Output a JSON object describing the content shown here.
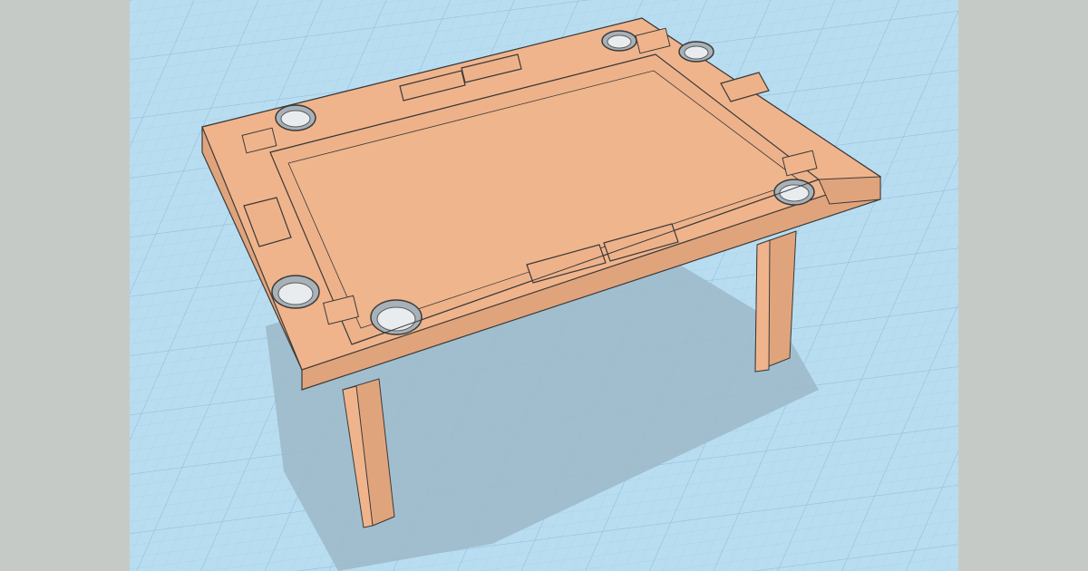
{
  "viewport": {
    "background": "#b9ddf0",
    "grid_minor": "#a6d0e8",
    "grid_major": "#8fc0de"
  },
  "side_bars": {
    "color": "#c6cac6"
  },
  "model": {
    "name_icon": "3d-game-table",
    "top_color": "#f0b48c",
    "side_color": "#e0a47c",
    "dark_side_color": "#c9916b",
    "edge_color": "#3a3a3a",
    "shadow_color": "#9cb8c8",
    "cupholder_count": 6,
    "card_slot_count": 6,
    "leg_count": 4
  }
}
